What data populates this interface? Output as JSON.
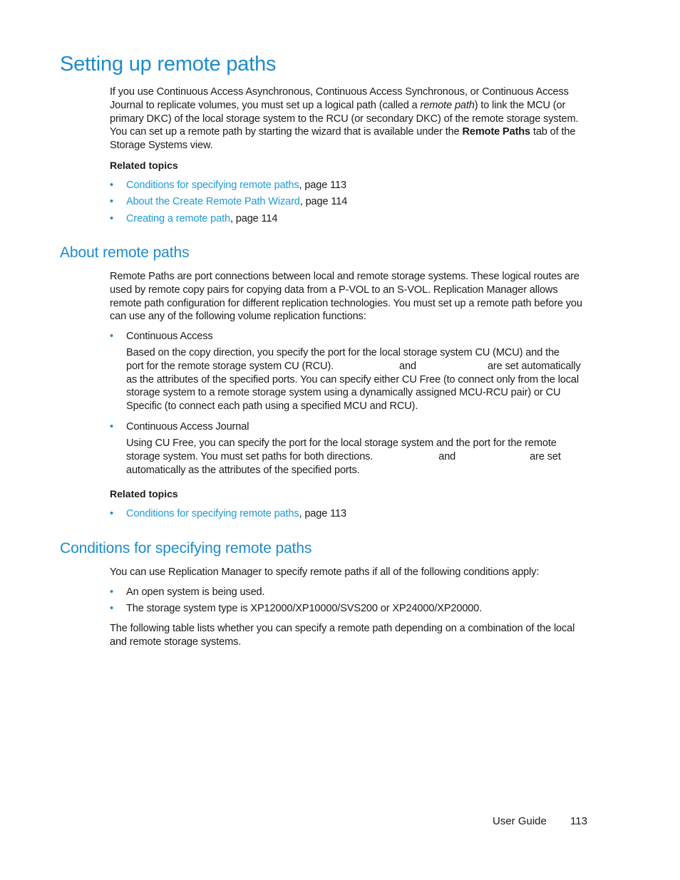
{
  "section1": {
    "title": "Setting up remote paths",
    "intro": {
      "part1": "If you use Continuous Access Asynchronous, Continuous Access Synchronous, or Continuous Access Journal to replicate volumes, you must set up a logical path (called a ",
      "italic": "remote path",
      "part2": ") to link the MCU (or primary DKC) of the local storage system to the RCU (or secondary DKC) of the remote storage system. You can set up a remote path by starting the wizard that is available under the ",
      "bold": "Remote Paths",
      "part3": " tab of the Storage Systems view."
    },
    "related_label": "Related topics",
    "related": [
      {
        "link": "Conditions for specifying remote paths",
        "suffix": ", page 113"
      },
      {
        "link": "About the Create Remote Path Wizard",
        "suffix": ", page 114"
      },
      {
        "link": "Creating a remote path",
        "suffix": ", page 114"
      }
    ]
  },
  "section2": {
    "title": "About remote paths",
    "intro": "Remote Paths are port connections between local and remote storage systems. These logical routes are used by remote copy pairs for copying data from a P-VOL to an S-VOL. Replication Manager allows remote path configuration for different replication technologies. You must set up a remote path before you can use any of the following volume replication functions:",
    "items": [
      {
        "label": "Continuous Access",
        "desc_line1": "Based on the copy direction, you specify the port for the local storage system CU (MCU) and the",
        "desc_line2a": "port for the remote storage system CU (RCU).",
        "desc_line2b": "and",
        "desc_line2c": "are set automatically",
        "desc_rest": "as the attributes of the specified ports. You can specify either CU Free (to connect only from the local storage system to a remote storage system using a dynamically assigned MCU-RCU pair) or CU Specific (to connect each path using a specified MCU and RCU)."
      },
      {
        "label": "Continuous Access Journal",
        "desc_line1": "Using CU Free, you can specify the port for the local storage system and the port for the remote",
        "desc_line2a": "storage system. You must set paths for both directions.",
        "desc_line2b": "and",
        "desc_line2c": "are set",
        "desc_rest": "automatically as the attributes of the specified ports."
      }
    ],
    "related_label": "Related topics",
    "related": [
      {
        "link": "Conditions for specifying remote paths",
        "suffix": ", page 113"
      }
    ]
  },
  "section3": {
    "title": "Conditions for specifying remote paths",
    "intro": "You can use Replication Manager to specify remote paths if all of the following conditions apply:",
    "conditions": [
      "An open system is being used.",
      "The storage system type is XP12000/XP10000/SVS200 or XP24000/XP20000."
    ],
    "outro": "The following table lists whether you can specify a remote path depending on a combination of the local and remote storage systems."
  },
  "footer": {
    "guide": "User Guide",
    "page": "113"
  },
  "bullet": "•"
}
